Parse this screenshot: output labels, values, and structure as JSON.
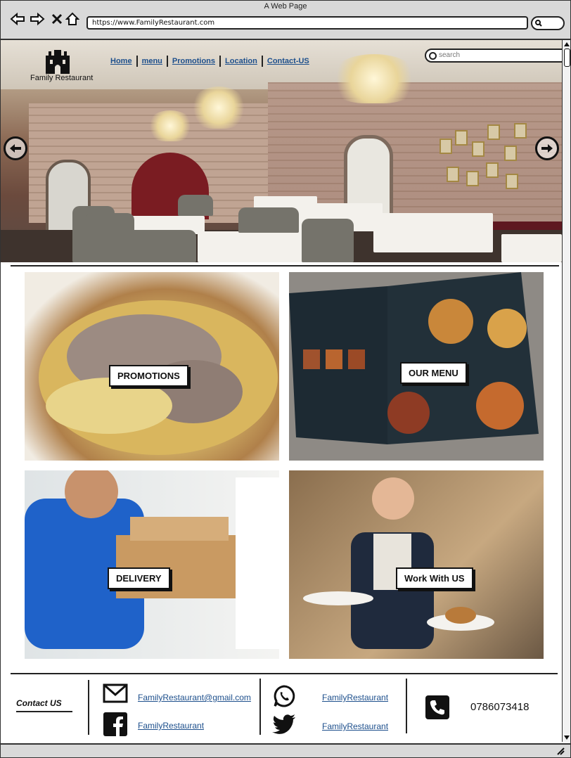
{
  "window": {
    "title": "A Web Page"
  },
  "browser": {
    "url": "https://www.FamilyRestaurant.com",
    "icons": [
      "back-arrow-icon",
      "forward-arrow-icon",
      "close-icon",
      "home-icon",
      "search-icon"
    ]
  },
  "header": {
    "brand": "Family Restaurant",
    "logo_icon": "castle-icon",
    "nav": [
      {
        "label": "Home"
      },
      {
        "label": "menu"
      },
      {
        "label": "Promotions"
      },
      {
        "label": "Location"
      },
      {
        "label": "Contact-US"
      }
    ],
    "search_placeholder": "search"
  },
  "carousel": {
    "prev_icon": "arrow-left-icon",
    "next_icon": "arrow-right-icon"
  },
  "tiles": [
    {
      "label": "PROMOTIONS"
    },
    {
      "label": "OUR MENU"
    },
    {
      "label": "DELIVERY"
    },
    {
      "label": "Work With US"
    }
  ],
  "footer": {
    "contact_heading": "Contact US",
    "email": "FamilyRestaurant@gmail.com",
    "facebook": "FamilyRestaurant",
    "whatsapp": "FamilyRestaurant",
    "twitter": "FamilyRestaurant",
    "phone": "0786073418"
  },
  "colors": {
    "link": "#1d4f8c",
    "chrome": "#d9d9d9",
    "border": "#222222"
  }
}
